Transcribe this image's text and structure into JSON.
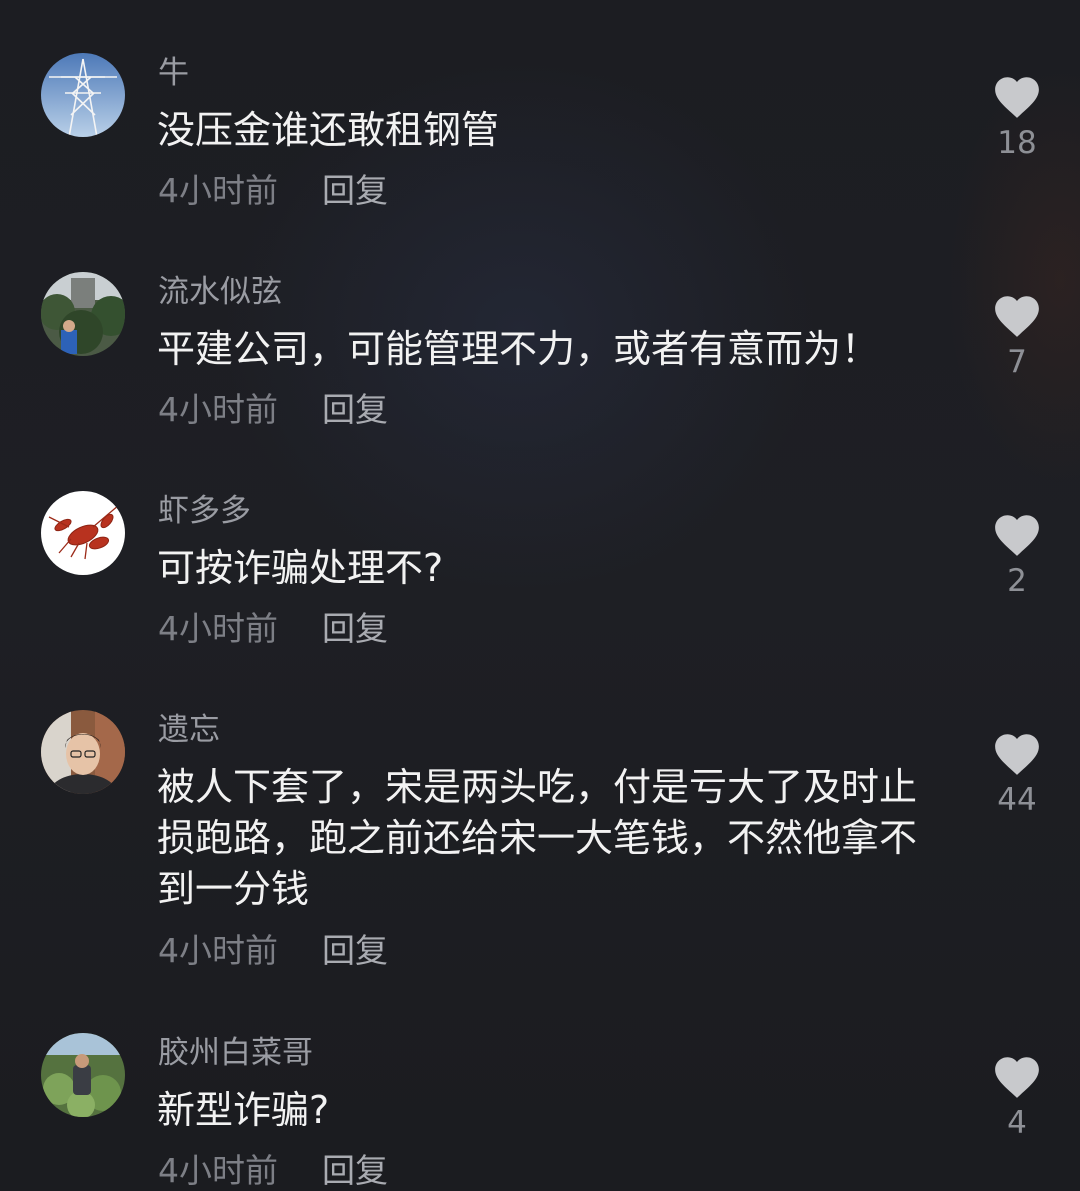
{
  "comments": [
    {
      "username": "牛",
      "text": "没压金谁还敢租钢管",
      "time": "4小时前",
      "reply": "回复",
      "likes": "18",
      "avatar_icon": "power-tower-avatar"
    },
    {
      "username": "流水似弦",
      "text": "平建公司，可能管理不力，或者有意而为！",
      "time": "4小时前",
      "reply": "回复",
      "likes": "7",
      "avatar_icon": "garden-portrait-avatar"
    },
    {
      "username": "虾多多",
      "text": "可按诈骗处理不?",
      "time": "4小时前",
      "reply": "回复",
      "likes": "2",
      "avatar_icon": "crayfish-avatar"
    },
    {
      "username": "遗忘",
      "text": "被人下套了，宋是两头吃，付是亏大了及时止损跑路，跑之前还给宋一大笔钱，不然他拿不到一分钱",
      "time": "4小时前",
      "reply": "回复",
      "likes": "44",
      "avatar_icon": "selfie-avatar"
    },
    {
      "username": "胶州白菜哥",
      "text": "新型诈骗?",
      "time": "4小时前",
      "reply": "回复",
      "likes": "4",
      "avatar_icon": "cabbage-field-avatar"
    }
  ],
  "colors": {
    "background": "#1b1c20",
    "username": "#9a9ca3",
    "comment_text": "#f2f2f2",
    "meta_text": "#7d7f86",
    "heart": "#c8c9cc"
  }
}
